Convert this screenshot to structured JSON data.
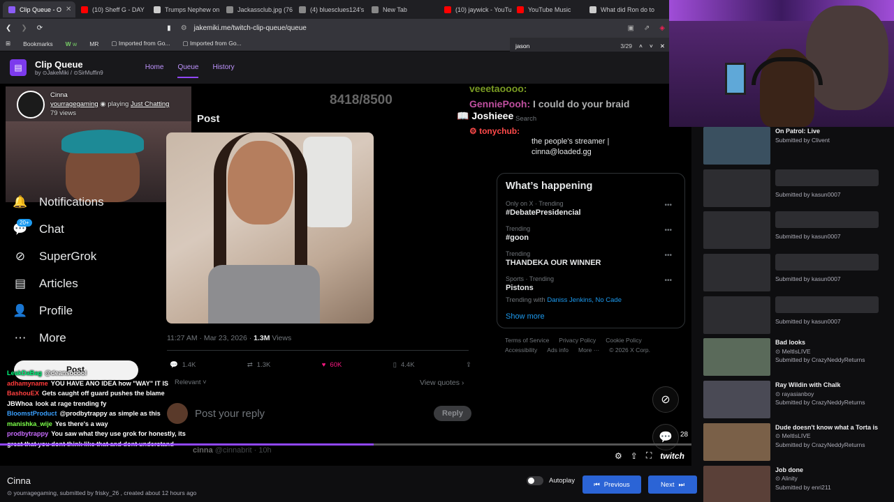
{
  "browser": {
    "tabs": [
      {
        "label": "Clip Queue - O",
        "color": "#8b5cf6",
        "active": true
      },
      {
        "label": "(10) Sheff G - DAY",
        "color": "#ff0000"
      },
      {
        "label": "Trumps Nephew on",
        "color": "#cccccc"
      },
      {
        "label": "Jackassclub.jpg (76",
        "color": "#888888"
      },
      {
        "label": "(4) bluesclues124's",
        "color": "#888888"
      },
      {
        "label": "New Tab",
        "color": "#888888"
      },
      {
        "label": "(10) jaywick - YouTu",
        "color": "#ff0000"
      },
      {
        "label": "YouTube Music",
        "color": "#ff0000"
      },
      {
        "label": "What did Ron do to",
        "color": "#cccccc"
      }
    ],
    "url": "jakemiki.me/twitch-clip-queue/queue",
    "bookmarks": [
      "Bookmarks",
      "w",
      "MR",
      "Imported from Go...",
      "Imported from Go..."
    ],
    "find": {
      "query": "jason",
      "count": "3/29"
    }
  },
  "site": {
    "title": "Clip Queue",
    "by_prefix": "by",
    "author1": "JakeMiki",
    "author2": "SirMuffin9",
    "nav": [
      "Home",
      "Queue",
      "History"
    ]
  },
  "clip_owner": {
    "name": "Cinna",
    "channel": "yourragegaming",
    "playing_prefix": "playing",
    "game": "Just Chatting",
    "views": "79 views"
  },
  "x_left_nav": [
    {
      "icon": "bell-icon",
      "label": "Notifications",
      "glyph": "🔔"
    },
    {
      "icon": "chat-icon",
      "label": "Chat",
      "glyph": "💬",
      "badge": "20+"
    },
    {
      "icon": "grok-icon",
      "label": "SuperGrok",
      "glyph": "⊘"
    },
    {
      "icon": "articles-icon",
      "label": "Articles",
      "glyph": "▤"
    },
    {
      "icon": "profile-icon",
      "label": "Profile",
      "glyph": "👤"
    },
    {
      "icon": "more-icon",
      "label": "More",
      "glyph": "⋯"
    }
  ],
  "overlay_counter": "8418/8500",
  "post": {
    "heading": "Post",
    "timestamp": "11:27 AM · Mar 23, 2026 · ",
    "views_num": "1.3M",
    "views_label": " Views",
    "replies": "1.4K",
    "reposts": "1.3K",
    "likes": "60K",
    "bookmarks": "4.4K",
    "relevant": "Relevant",
    "view_quotes": "View quotes",
    "reply_placeholder": "Post your reply",
    "reply_button": "Reply",
    "next_author": "cinna",
    "next_handle": "@cinnabrit · 10h"
  },
  "x_right": {
    "bio": "the people's streamer |",
    "email": "cinna@loaded.gg",
    "search": "Search",
    "happening_title": "What’s happening",
    "trends": [
      {
        "cat": "Only on X · Trending",
        "title": "#DebatePresidencial"
      },
      {
        "cat": "Trending",
        "title": "#goon"
      },
      {
        "cat": "Trending",
        "title": "THANDEKA OUR WINNER"
      },
      {
        "cat": "Sports · Trending",
        "title": "Pistons",
        "with_prefix": "Trending with",
        "with": "Daniss Jenkins, No Cade"
      }
    ],
    "show_more": "Show more",
    "footer": [
      "Terms of Service",
      "Privacy Policy",
      "Cookie Policy",
      "Accessibility",
      "Ads info",
      "More ···",
      "© 2026 X Corp."
    ]
  },
  "chat": [
    {
      "user": "LeakDaBag",
      "color": "#00ff7f",
      "msg": "@deansocool"
    },
    {
      "user": "adhamyname",
      "color": "#ff3a3a",
      "msg": "YOU HAVE ANO IDEA how \"WAY\" IT IS"
    },
    {
      "user": "BashouEX",
      "color": "#ff4040",
      "msg": "Gets caught off guard pushes the blame"
    },
    {
      "user": "JBWhoa",
      "color": "#ffffff",
      "msg": "look at rage trending fy"
    },
    {
      "user": "BloomstProduct",
      "color": "#3aa0ff",
      "msg": "@prodbytrappy as simple as this"
    },
    {
      "user": "manishka_wije",
      "color": "#7cff4a",
      "msg": "Yes there's a way"
    },
    {
      "user": "prodbytrappy",
      "color": "#c86bff",
      "msg": "You saw what they use grok for honestly, its great that you dont think like that and dont understand"
    }
  ],
  "stream_overlay": {
    "joshieee": "Joshieee",
    "tonychub": "tonychub:",
    "genniepooh": "GenniePooh:",
    "gennie_msg": "I could do your braid",
    "veet": "veeetaoooo:"
  },
  "player": {
    "comment_count": "28"
  },
  "clip_info": {
    "title": "Cinna",
    "channel": "yourragegaming",
    "submitted": ", submitted by frisky_26 , created about 12 hours ago"
  },
  "controls": {
    "autoplay": "Autoplay",
    "previous": "Previous",
    "next": "Next"
  },
  "queue": [
    {
      "title": "On Patrol: Live",
      "by": "Submitted by Clivent",
      "thumb": "#3a5060",
      "placeholder": false
    },
    {
      "title": "",
      "by": "Submitted by kasun0007",
      "thumb": "#2d2d31",
      "placeholder": true
    },
    {
      "title": "",
      "by": "Submitted by kasun0007",
      "thumb": "#2d2d31",
      "placeholder": true
    },
    {
      "title": "",
      "by": "Submitted by kasun0007",
      "thumb": "#2d2d31",
      "placeholder": true
    },
    {
      "title": "",
      "by": "Submitted by kasun0007",
      "thumb": "#2d2d31",
      "placeholder": true
    },
    {
      "title": "Bad looks",
      "channel": "MeltIsLIVE",
      "by": "Submitted by CrazyNeddyReturns",
      "thumb": "#5a6a5a",
      "placeholder": false
    },
    {
      "title": "Ray Wildin with Chalk",
      "channel": "rayasianboy",
      "by": "Submitted by CrazyNeddyReturns",
      "thumb": "#4a4a55",
      "placeholder": false
    },
    {
      "title": "Dude doesn't know what a Torta is",
      "channel": "MeltIsLIVE",
      "by": "Submitted by CrazyNeddyReturns",
      "thumb": "#7a6048",
      "placeholder": false
    },
    {
      "title": "Job done",
      "channel": "Alinity",
      "by": "Submitted by enri211",
      "thumb": "#5a4038",
      "placeholder": false
    }
  ]
}
